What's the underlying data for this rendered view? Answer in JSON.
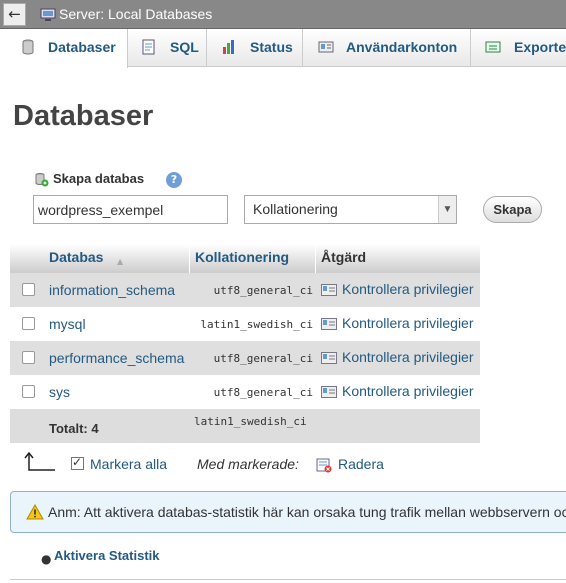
{
  "topbar": {
    "back_symbol": "←",
    "title": "Server: Local Databases"
  },
  "tabs": [
    {
      "label": "Databaser",
      "icon": "database-icon",
      "active": true
    },
    {
      "label": "SQL",
      "icon": "sql-icon"
    },
    {
      "label": "Status",
      "icon": "status-chart-icon"
    },
    {
      "label": "Användarkonton",
      "icon": "user-accounts-icon"
    },
    {
      "label": "Exporte",
      "icon": "export-icon"
    }
  ],
  "page_title": "Databaser",
  "create": {
    "label": "Skapa databas",
    "help_symbol": "?",
    "db_name_value": "wordpress_exempel",
    "collation_selected": "Kollationering",
    "button_label": "Skapa"
  },
  "table": {
    "headers": {
      "database": "Databas",
      "collation": "Kollationering",
      "action": "Åtgärd"
    },
    "rows": [
      {
        "name": "information_schema",
        "collation": "utf8_general_ci",
        "action": "Kontrollera privilegier"
      },
      {
        "name": "mysql",
        "collation": "latin1_swedish_ci",
        "action": "Kontrollera privilegier"
      },
      {
        "name": "performance_schema",
        "collation": "utf8_general_ci",
        "action": "Kontrollera privilegier"
      },
      {
        "name": "sys",
        "collation": "utf8_general_ci",
        "action": "Kontrollera privilegier"
      }
    ],
    "total_label": "Totalt: 4",
    "total_collation": "latin1_swedish_ci"
  },
  "bulk": {
    "mark_all": "Markera alla",
    "with_selected": "Med markerade:",
    "delete": "Radera"
  },
  "notice": {
    "text": "Anm: Att aktivera databas-statistik här kan orsaka tung trafik mellan webbservern och"
  },
  "stats_link": "Aktivera Statistik",
  "colors": {
    "link": "#235a81",
    "topbar": "#888888",
    "notice_bg": "#eaf4fb"
  }
}
